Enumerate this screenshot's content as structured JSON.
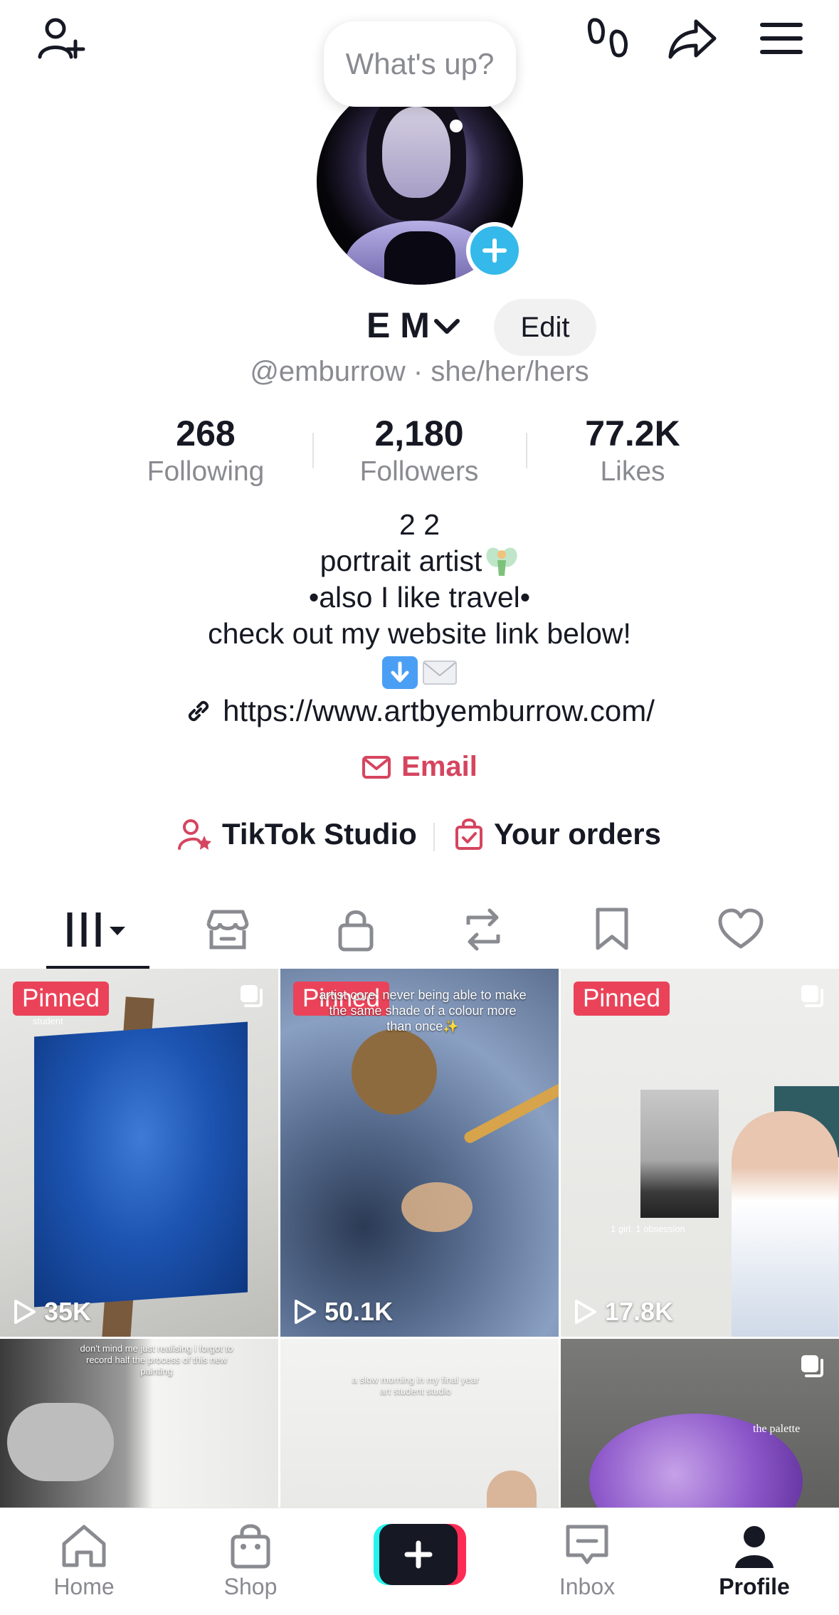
{
  "bubble": {
    "text": "What's up?"
  },
  "profile": {
    "display_name": "E M",
    "edit_label": "Edit",
    "handle": "@emburrow · she/her/hers"
  },
  "stats": [
    {
      "value": "268",
      "label": "Following"
    },
    {
      "value": "2,180",
      "label": "Followers"
    },
    {
      "value": "77.2K",
      "label": "Likes"
    }
  ],
  "bio": {
    "lines": [
      "2 2",
      "portrait artist",
      "•also I like travel•",
      "check out my website link below!"
    ],
    "emojis": [
      "arrow-down-emoji",
      "envelope-emoji"
    ],
    "fairy_emoji": "fairy-emoji"
  },
  "link": {
    "url": "https://www.artbyemburrow.com/"
  },
  "email": {
    "label": "Email"
  },
  "quick_actions": {
    "studio": "TikTok Studio",
    "orders": "Your orders"
  },
  "tabs": [
    "videos",
    "shop",
    "private",
    "reposts",
    "favorites",
    "liked"
  ],
  "videos": [
    {
      "pinned": "Pinned",
      "views": "35K",
      "overlay": "student"
    },
    {
      "pinned": "Pinned",
      "views": "50.1K",
      "overlay": "artist core: never being able to make the same shade of a colour more than once✨"
    },
    {
      "pinned": "Pinned",
      "views": "17.8K",
      "overlay": "1 girl. 1 obsession"
    },
    {
      "overlay": "don't mind me just realising i forgot to record half the process of this new painting"
    },
    {
      "overlay": "a slow morning in my final year art student studio"
    },
    {
      "overlay": "the palette"
    }
  ],
  "nav": {
    "home": "Home",
    "shop": "Shop",
    "inbox": "Inbox",
    "profile": "Profile"
  },
  "colors": {
    "accent_red": "#ea4359",
    "email_red": "#d5455f",
    "avatar_plus_blue": "#35b9ea",
    "text_primary": "#161823",
    "text_secondary": "#8a8b91"
  }
}
